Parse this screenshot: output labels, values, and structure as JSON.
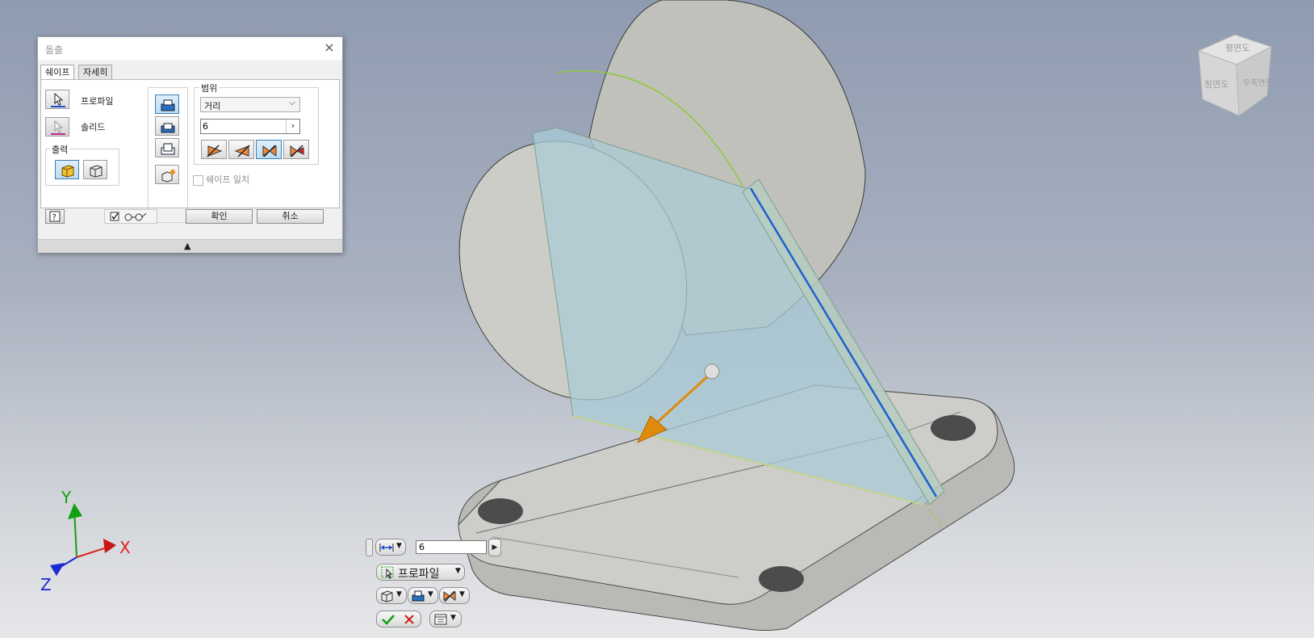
{
  "dialog": {
    "title": "돌출",
    "tabs": [
      {
        "label": "쉐이프"
      },
      {
        "label": "자세히"
      }
    ],
    "profile_label": "프로파일",
    "solid_label": "솔리드",
    "output_group_label": "출력",
    "range_group_label": "범위",
    "range_type": "거리",
    "distance_value": "6",
    "match_shape_label": "쉐이프 일치",
    "match_shape_checked": false,
    "ok_label": "확인",
    "cancel_label": "취소"
  },
  "mini_toolbar": {
    "distance_value": "6",
    "profile_label": "프로파일"
  },
  "viewcube": {
    "top_label": "평면도",
    "front_label": "정면도",
    "right_label": "우측면도"
  },
  "triad": {
    "x_label": "X",
    "y_label": "Y",
    "z_label": "Z"
  },
  "colors": {
    "selection_blue": "#1f5fd0",
    "preview_fill": "#a9cbd6",
    "arrow_orange": "#e08a0b",
    "axis_x": "#e02020",
    "axis_y": "#12a012",
    "axis_z": "#1a2bd0"
  }
}
